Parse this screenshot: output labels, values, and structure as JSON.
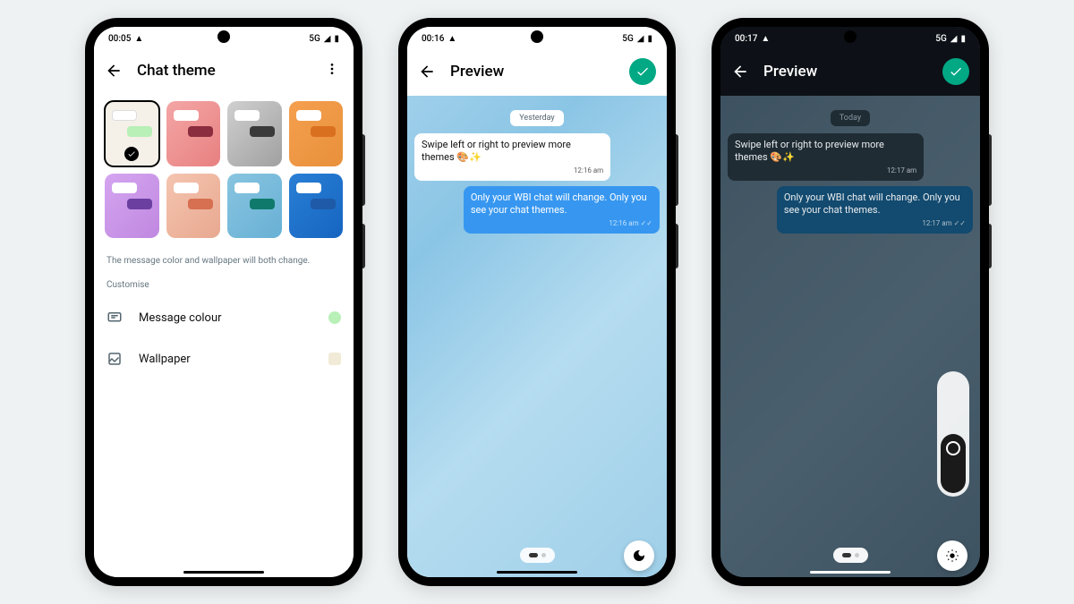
{
  "phones": {
    "theme_settings": {
      "status": {
        "time": "00:05",
        "network": "5G"
      },
      "title": "Chat theme",
      "info": "The message color and wallpaper will both change.",
      "customise_label": "Customise",
      "message_colour": {
        "label": "Message colour",
        "swatch": "#b8f0b8"
      },
      "wallpaper": {
        "label": "Wallpaper",
        "swatch": "#f0ead6"
      },
      "tiles": [
        {
          "bg": "#f5f0e8",
          "in": "#ffffff",
          "out": "#b8f0b8",
          "selected": true
        },
        {
          "bg": "linear-gradient(135deg,#f4a6a6,#e88080)",
          "in": "#ffffff",
          "out": "#8b2d3e"
        },
        {
          "bg": "linear-gradient(135deg,#d0d0d0,#a0a0a0)",
          "in": "#ffffff",
          "out": "#3a3a3a"
        },
        {
          "bg": "linear-gradient(135deg,#f5a050,#e8903a)",
          "in": "#ffffff",
          "out": "#d97020"
        },
        {
          "bg": "linear-gradient(135deg,#d4a5f0,#c088e0)",
          "in": "#ffffff",
          "out": "#6b3fa0"
        },
        {
          "bg": "linear-gradient(135deg,#f5c5b0,#e8a890)",
          "in": "#ffffff",
          "out": "#d67050"
        },
        {
          "bg": "linear-gradient(135deg,#88c5e0,#68b0d5)",
          "in": "#ffffff",
          "out": "#0f7a6b"
        },
        {
          "bg": "linear-gradient(135deg,#2a7fd5,#1565c0)",
          "in": "#ffffff",
          "out": "#1e5aa8"
        }
      ]
    },
    "preview_light": {
      "status": {
        "time": "00:16",
        "network": "5G"
      },
      "title": "Preview",
      "date": "Yesterday",
      "msg_in": "Swipe left or right to preview more themes 🎨✨",
      "msg_in_time": "12:16 am",
      "msg_out": "Only your WBI chat will change. Only you see your chat themes.",
      "msg_out_time": "12:16 am"
    },
    "preview_dark": {
      "status": {
        "time": "00:17",
        "network": "5G"
      },
      "title": "Preview",
      "date": "Today",
      "msg_in": "Swipe left or right to preview more themes 🎨✨",
      "msg_in_time": "12:17 am",
      "msg_out": "Only your WBI chat will change. Only you see your chat themes.",
      "msg_out_time": "12:17 am"
    }
  }
}
